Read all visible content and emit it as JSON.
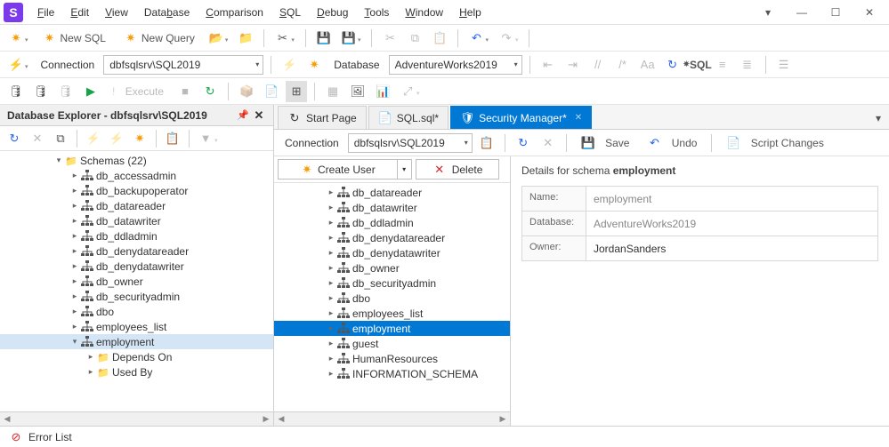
{
  "menu": {
    "file": "File",
    "edit": "Edit",
    "view": "View",
    "database": "Database",
    "comparison": "Comparison",
    "sql": "SQL",
    "debug": "Debug",
    "tools": "Tools",
    "window": "Window",
    "help": "Help"
  },
  "toolbar1": {
    "new_sql": "New SQL",
    "new_query": "New Query"
  },
  "toolbar2": {
    "connection_label": "Connection",
    "connection_value": "dbfsqlsrv\\SQL2019",
    "database_label": "Database",
    "database_value": "AdventureWorks2019",
    "sql_icon_label": "SQL"
  },
  "toolbar3": {
    "execute": "Execute"
  },
  "explorer": {
    "title": "Database Explorer - dbfsqlsrv\\SQL2019",
    "schemas_label": "Schemas (22)",
    "items": [
      "db_accessadmin",
      "db_backupoperator",
      "db_datareader",
      "db_datawriter",
      "db_ddladmin",
      "db_denydatareader",
      "db_denydatawriter",
      "db_owner",
      "db_securityadmin",
      "dbo",
      "employees_list",
      "employment"
    ],
    "sub": {
      "depends": "Depends On",
      "usedby": "Used By"
    }
  },
  "tabs": {
    "start": "Start Page",
    "sql": "SQL.sql*",
    "security": "Security Manager*"
  },
  "sm_toolbar": {
    "connection_label": "Connection",
    "connection_value": "dbfsqlsrv\\SQL2019",
    "save": "Save",
    "undo": "Undo",
    "script": "Script Changes"
  },
  "sm_actions": {
    "create_user": "Create User",
    "delete": "Delete"
  },
  "sm_tree": [
    "db_datareader",
    "db_datawriter",
    "db_ddladmin",
    "db_denydatareader",
    "db_denydatawriter",
    "db_owner",
    "db_securityadmin",
    "dbo",
    "employees_list",
    "employment",
    "guest",
    "HumanResources",
    "INFORMATION_SCHEMA"
  ],
  "sm_tree_selected": "employment",
  "details": {
    "heading_a": "Details for schema ",
    "heading_b": "employment",
    "name_lbl": "Name:",
    "name_val": "employment",
    "db_lbl": "Database:",
    "db_val": "AdventureWorks2019",
    "owner_lbl": "Owner:",
    "owner_val": "JordanSanders"
  },
  "status": {
    "error_list": "Error List"
  }
}
